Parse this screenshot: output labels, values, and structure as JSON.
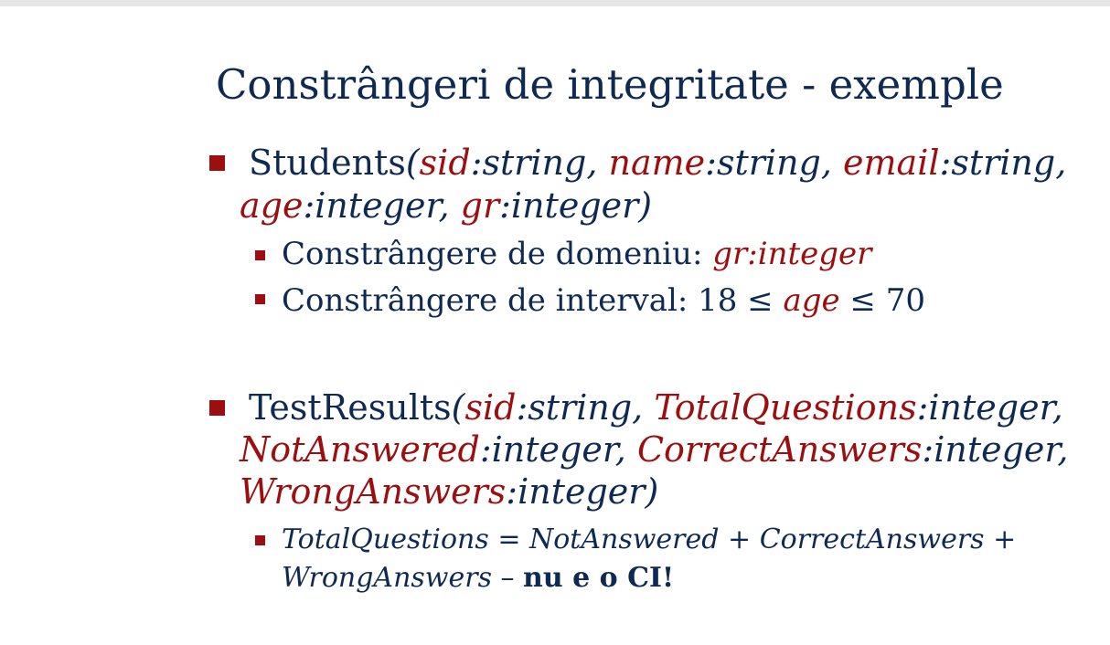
{
  "slide": {
    "title": "Constrângeri de integritate - exemple",
    "students": {
      "name": "Students",
      "attrs": [
        {
          "n": "sid",
          "t": ":string, "
        },
        {
          "n": "name",
          "t": ":string, "
        },
        {
          "n": "email",
          "t": ":string,"
        },
        {
          "n": "age",
          "t": ":integer, "
        },
        {
          "n": "gr",
          "t": ":integer)"
        }
      ],
      "open_paren": "(",
      "sub1": {
        "label": "Constrângere de domeniu: ",
        "attr": "gr",
        "type": ":integer"
      },
      "sub2": {
        "label": "Constrângere de interval: 18 ≤ ",
        "attr": "age",
        "tail": " ≤ 70"
      }
    },
    "testresults": {
      "name": "TestResults",
      "open_paren": "(",
      "attrs": [
        {
          "n": "sid",
          "t": ":string, "
        },
        {
          "n": "TotalQuestions",
          "t": ":integer,"
        },
        {
          "n": "NotAnswered",
          "t": ":integer, "
        },
        {
          "n": "CorrectAnswers",
          "t": ":integer,"
        },
        {
          "n": "WrongAnswers",
          "t": ":integer)"
        }
      ],
      "formula": {
        "a": "TotalQuestions",
        "eq": " = ",
        "b": "NotAnswered",
        "plus1": " + ",
        "c": "CorrectAnswers",
        "plus2": " +",
        "d": "WrongAnswers",
        "dash": " – ",
        "note": "nu e o CI!"
      }
    },
    "colors": {
      "text": "#0f2a52",
      "accent": "#9b0f10"
    }
  }
}
